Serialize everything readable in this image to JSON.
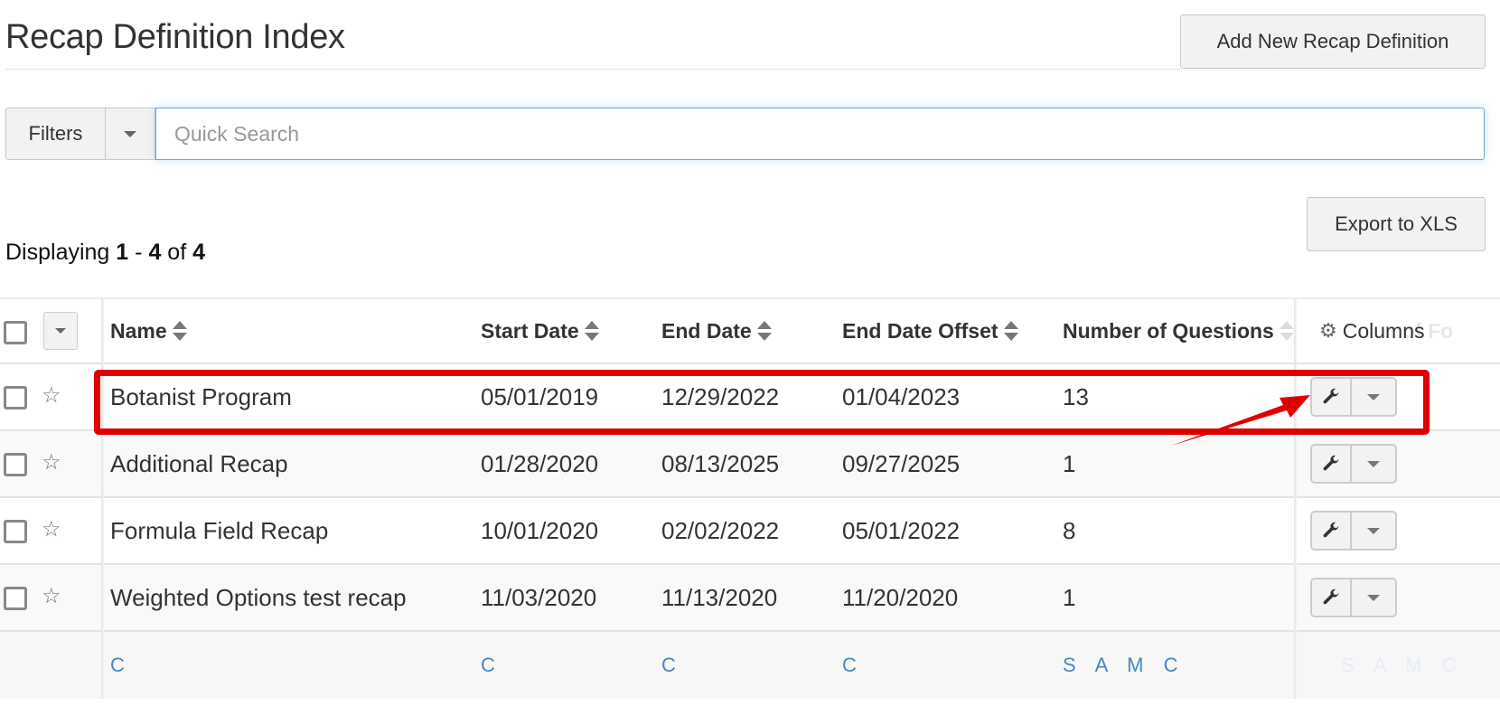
{
  "page": {
    "title": "Recap Definition Index",
    "add_button_label": "Add New Recap Definition"
  },
  "filter_bar": {
    "filters_label": "Filters",
    "filters_dropdown_icon": "caret-down-icon",
    "search_placeholder": "Quick Search",
    "search_value": ""
  },
  "results": {
    "prefix": "Displaying",
    "range_start": "1",
    "separator": "-",
    "range_end": "4",
    "of_label": "of",
    "total": "4"
  },
  "export_button_label": "Export to XLS",
  "table": {
    "columns": [
      {
        "label": "Name",
        "sortable": true
      },
      {
        "label": "Start Date",
        "sortable": true
      },
      {
        "label": "End Date",
        "sortable": true
      },
      {
        "label": "End Date Offset",
        "sortable": true
      },
      {
        "label": "Number of Questions",
        "sortable": true
      }
    ],
    "pinned_column_label": "Columns",
    "hidden_column_fragment": "of Fo",
    "rows": [
      {
        "name": "Botanist Program",
        "start_date": "05/01/2019",
        "end_date": "12/29/2022",
        "end_date_offset": "01/04/2023",
        "num_questions": "13",
        "highlighted": true
      },
      {
        "name": "Additional Recap",
        "start_date": "01/28/2020",
        "end_date": "08/13/2025",
        "end_date_offset": "09/27/2025",
        "num_questions": "1",
        "highlighted": false
      },
      {
        "name": "Formula Field Recap",
        "start_date": "10/01/2020",
        "end_date": "02/02/2022",
        "end_date_offset": "05/01/2022",
        "num_questions": "8",
        "highlighted": false
      },
      {
        "name": "Weighted Options test recap",
        "start_date": "11/03/2020",
        "end_date": "11/13/2020",
        "end_date_offset": "11/20/2020",
        "num_questions": "1",
        "highlighted": false
      }
    ],
    "footer": {
      "name": "C",
      "start_date": "C",
      "end_date": "C",
      "end_date_offset": "C",
      "num_questions": "S A M C",
      "hidden_column": "S A M C"
    }
  },
  "annotation": {
    "color": "#e00000",
    "target": "row-0 action wrench button"
  },
  "colors": {
    "link": "#4a86c8",
    "search_focus": "#6fa5e0",
    "annotation": "#e00000"
  }
}
